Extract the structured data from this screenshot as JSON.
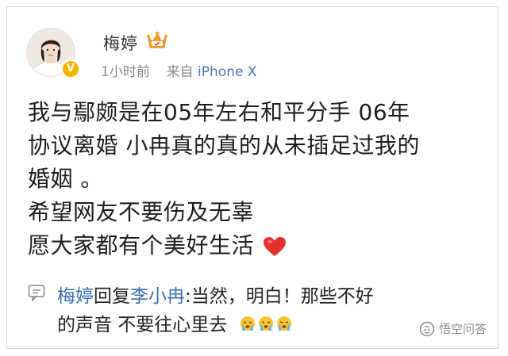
{
  "post": {
    "author": "梅婷",
    "time": "1小时前",
    "source_prefix": "来自",
    "source_device": "iPhone X",
    "lines": [
      "我与鄢颇是在05年左右和平分手  06年",
      "协议离婚 小冉真的真的从未插足过我的",
      "婚姻 。",
      "希望网友不要伤及无辜",
      "愿大家都有个美好生活"
    ]
  },
  "reply": {
    "author": "梅婷",
    "reply_word": "回复",
    "target": "李小冉",
    "line1_text": ":当然，明白！那些不好",
    "line2_text": "的声音 不要往心里去"
  },
  "watermark": {
    "text": "悟空问答"
  },
  "colors": {
    "link": "#3d6eb5",
    "meta": "#8a8a8a",
    "verified": "#f6b300",
    "heart": "#e8312f"
  }
}
